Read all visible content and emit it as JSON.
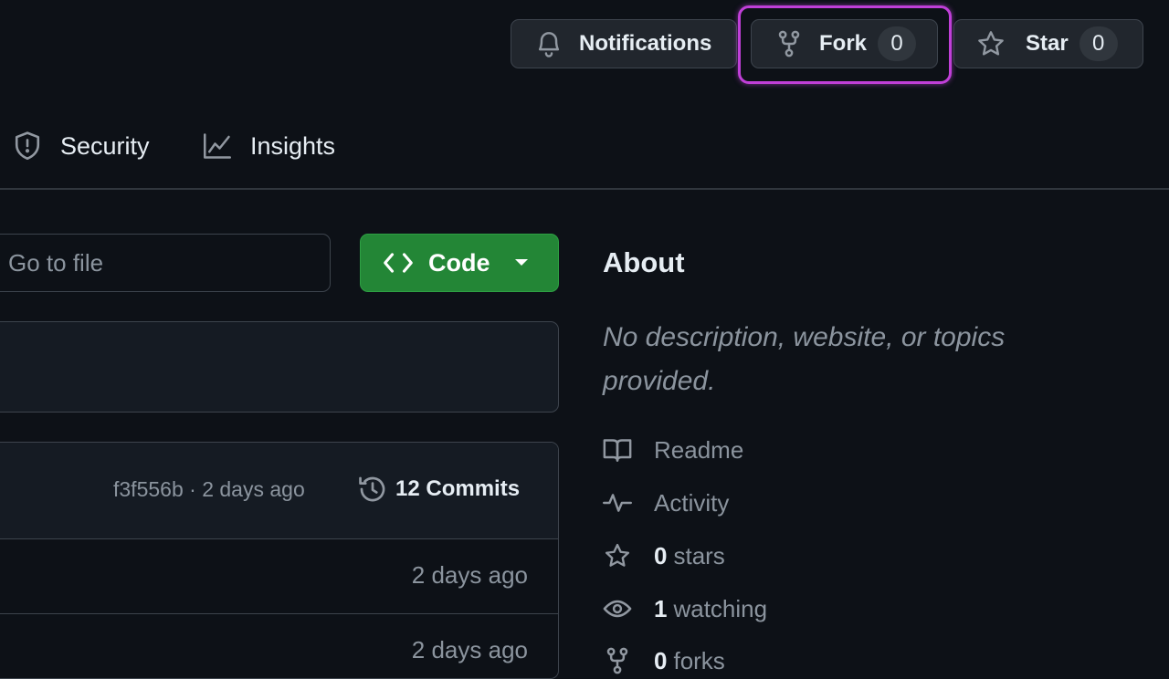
{
  "header": {
    "notifications_label": "Notifications",
    "fork_label": "Fork",
    "fork_count": "0",
    "star_label": "Star",
    "star_count": "0"
  },
  "nav": {
    "tabs": [
      {
        "label": "Security",
        "icon": "shield-icon"
      },
      {
        "label": "Insights",
        "icon": "graph-icon"
      }
    ]
  },
  "toolbar": {
    "goto_placeholder": "Go to file",
    "code_label": "Code"
  },
  "commits": {
    "hash": "f3f556b",
    "separator": "·",
    "time": "2 days ago",
    "count_label": "12 Commits"
  },
  "files": [
    {
      "date": "2 days ago"
    },
    {
      "date": "2 days ago"
    }
  ],
  "about": {
    "title": "About",
    "description": "No description, website, or topics provided.",
    "items": [
      {
        "icon": "book-icon",
        "label": "Readme",
        "count": ""
      },
      {
        "icon": "pulse-icon",
        "label": "Activity",
        "count": ""
      },
      {
        "icon": "star-icon",
        "label": "stars",
        "count": "0"
      },
      {
        "icon": "eye-icon",
        "label": "watching",
        "count": "1"
      },
      {
        "icon": "fork-icon",
        "label": "forks",
        "count": "0"
      }
    ]
  },
  "colors": {
    "background": "#0d1117",
    "accent_green": "#238636",
    "highlight": "#c03fd8"
  }
}
